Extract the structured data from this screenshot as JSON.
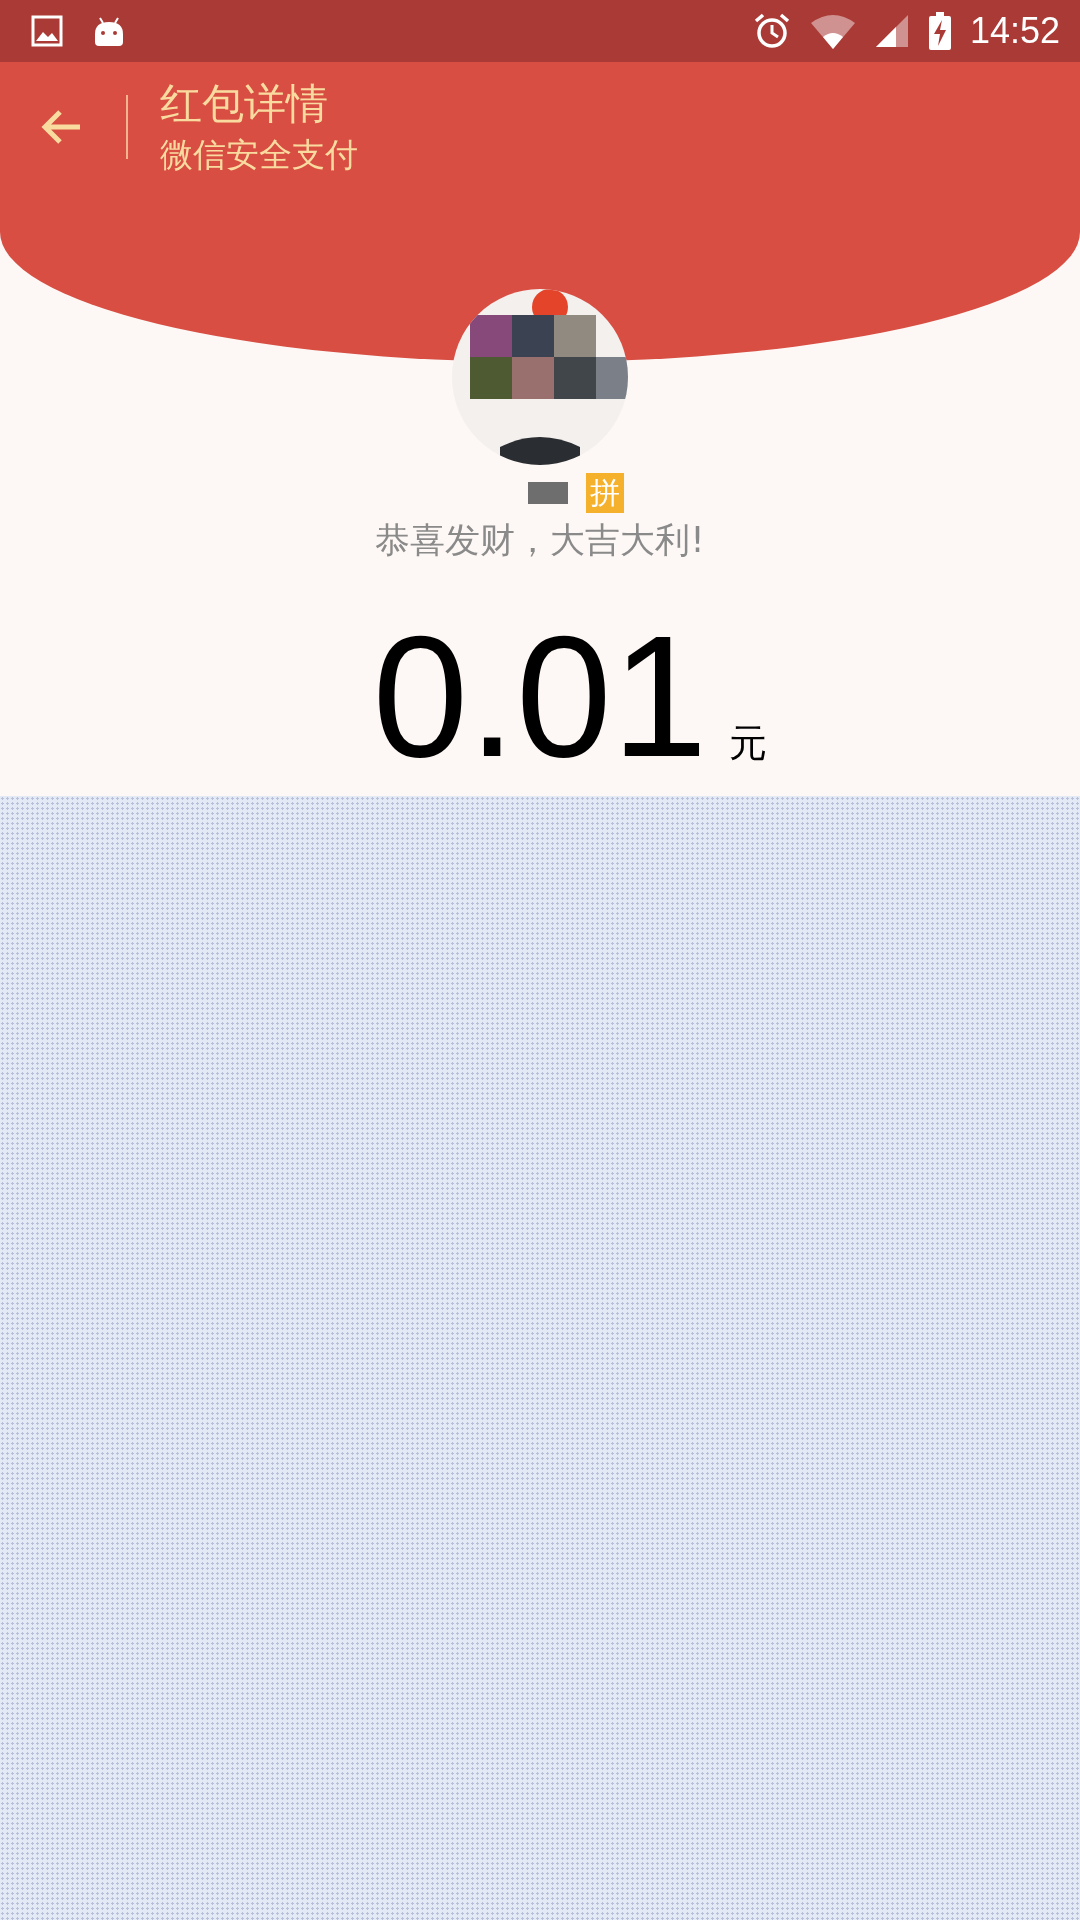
{
  "status_bar": {
    "time": "14:52"
  },
  "header": {
    "title": "红包详情",
    "subtitle": "微信安全支付"
  },
  "sender": {
    "badge": "拼"
  },
  "greeting": "恭喜发财，大吉大利!",
  "amount": {
    "value": "0.01",
    "unit": "元"
  }
}
